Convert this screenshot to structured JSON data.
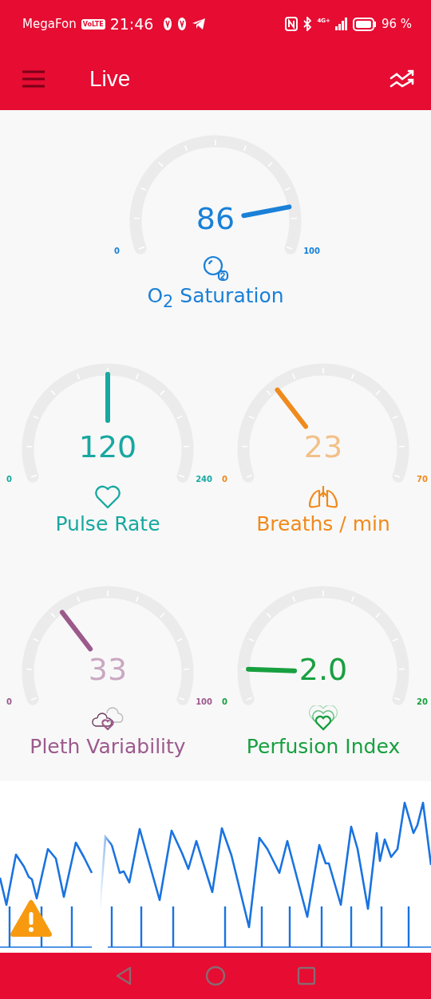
{
  "status_bar": {
    "carrier": "MegaFon",
    "volte": "VoLTE",
    "time": "21:46",
    "network": "4G+",
    "battery": "96 %"
  },
  "app_bar": {
    "title": "Live"
  },
  "gauges": [
    {
      "kind": "oxygen",
      "value": "86",
      "min": "0",
      "max": "100",
      "label": "O$_{2}$ Saturation",
      "color": "#1a80d8",
      "dimmed": false
    },
    {
      "kind": "heart",
      "value": "120",
      "min": "0",
      "max": "240",
      "label": "Pulse Rate",
      "color": "#18a8a0",
      "dimmed": false
    },
    {
      "kind": "lungs",
      "value": "23",
      "min": "0",
      "max": "70",
      "label": "Breaths / min",
      "color": "#f08a1c",
      "dimmed": true
    },
    {
      "kind": "pleth",
      "value": "33",
      "min": "0",
      "max": "100",
      "label": "Pleth Variability",
      "color": "#9c5a8c",
      "dimmed": true
    },
    {
      "kind": "perfusion",
      "value": "2.0",
      "min": "0",
      "max": "20",
      "label": "Perfusion Index",
      "color": "#18a040",
      "dimmed": false
    }
  ]
}
